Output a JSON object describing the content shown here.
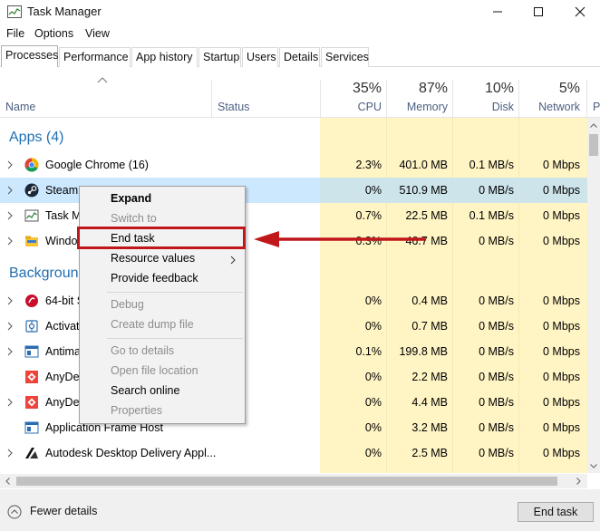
{
  "window": {
    "title": "Task Manager",
    "controls": {
      "minimize": "—",
      "maximize": "☐",
      "close": "✕"
    }
  },
  "menu": [
    "File",
    "Options",
    "View"
  ],
  "tabs": [
    {
      "label": "Processes",
      "active": true
    },
    {
      "label": "Performance",
      "active": false
    },
    {
      "label": "App history",
      "active": false
    },
    {
      "label": "Startup",
      "active": false
    },
    {
      "label": "Users",
      "active": false
    },
    {
      "label": "Details",
      "active": false
    },
    {
      "label": "Services",
      "active": false
    }
  ],
  "columns": {
    "name": "Name",
    "status": "Status",
    "cpu": {
      "pct": "35%",
      "label": "CPU"
    },
    "memory": {
      "pct": "87%",
      "label": "Memory"
    },
    "disk": {
      "pct": "10%",
      "label": "Disk"
    },
    "network": {
      "pct": "5%",
      "label": "Network"
    },
    "power_partial": "P"
  },
  "groups": {
    "apps": "Apps (4)",
    "background": "Background processes (partial)",
    "background_visible": "Backgroun"
  },
  "rows": [
    {
      "name": "Google Chrome (16)",
      "icon": "chrome-icon",
      "cpu": "2.3%",
      "mem": "401.0 MB",
      "disk": "0.1 MB/s",
      "net": "0 Mbps",
      "expand": true
    },
    {
      "name": "Steam",
      "icon": "steam-icon",
      "cpu": "0%",
      "mem": "510.9 MB",
      "disk": "0 MB/s",
      "net": "0 Mbps",
      "expand": true,
      "selected": true
    },
    {
      "name": "Task M",
      "icon": "task-manager-icon",
      "cpu": "0.7%",
      "mem": "22.5 MB",
      "disk": "0.1 MB/s",
      "net": "0 Mbps",
      "expand": true
    },
    {
      "name": "Windo",
      "icon": "windows-explorer-icon",
      "cpu": "0.3%",
      "mem": "46.7 MB",
      "disk": "0 MB/s",
      "net": "0 Mbps",
      "expand": true
    },
    {
      "name": "64-bit S",
      "icon": "synaptics-icon",
      "cpu": "0%",
      "mem": "0.4 MB",
      "disk": "0 MB/s",
      "net": "0 Mbps",
      "expand": true
    },
    {
      "name": "Activat",
      "icon": "activation-icon",
      "cpu": "0%",
      "mem": "0.7 MB",
      "disk": "0 MB/s",
      "net": "0 Mbps",
      "expand": true
    },
    {
      "name": "Antima",
      "icon": "service-window-icon",
      "cpu": "0.1%",
      "mem": "199.8 MB",
      "disk": "0 MB/s",
      "net": "0 Mbps",
      "expand": true
    },
    {
      "name": "AnyDes",
      "icon": "anydesk-icon",
      "cpu": "0%",
      "mem": "2.2 MB",
      "disk": "0 MB/s",
      "net": "0 Mbps",
      "expand": false
    },
    {
      "name": "AnyDes",
      "icon": "anydesk-icon",
      "cpu": "0%",
      "mem": "4.4 MB",
      "disk": "0 MB/s",
      "net": "0 Mbps",
      "expand": true
    },
    {
      "name": "Application Frame Host",
      "icon": "service-window-icon",
      "cpu": "0%",
      "mem": "3.2 MB",
      "disk": "0 MB/s",
      "net": "0 Mbps",
      "expand": false
    },
    {
      "name": "Autodesk Desktop Delivery Appl...",
      "icon": "autodesk-icon",
      "cpu": "0%",
      "mem": "2.5 MB",
      "disk": "0 MB/s",
      "net": "0 Mbps",
      "expand": true
    }
  ],
  "context_menu": {
    "items": [
      {
        "label": "Expand",
        "style": "bold"
      },
      {
        "label": "Switch to",
        "style": "disabled"
      },
      {
        "label": "End task",
        "style": "normal",
        "highlighted": true
      },
      {
        "label": "Resource values",
        "style": "normal",
        "submenu": true
      },
      {
        "label": "Provide feedback",
        "style": "normal"
      },
      {
        "label": "Debug",
        "style": "disabled"
      },
      {
        "label": "Create dump file",
        "style": "disabled"
      },
      {
        "label": "Go to details",
        "style": "disabled"
      },
      {
        "label": "Open file location",
        "style": "disabled"
      },
      {
        "label": "Search online",
        "style": "normal"
      },
      {
        "label": "Properties",
        "style": "disabled"
      }
    ]
  },
  "footer": {
    "fewer_details": "Fewer details",
    "end_task": "End task"
  },
  "colors": {
    "highlight_red": "#c0171b",
    "heat_yellow": "#fff4c4",
    "selection_blue": "#cce8ff",
    "group_blue": "#1f6fb3"
  }
}
